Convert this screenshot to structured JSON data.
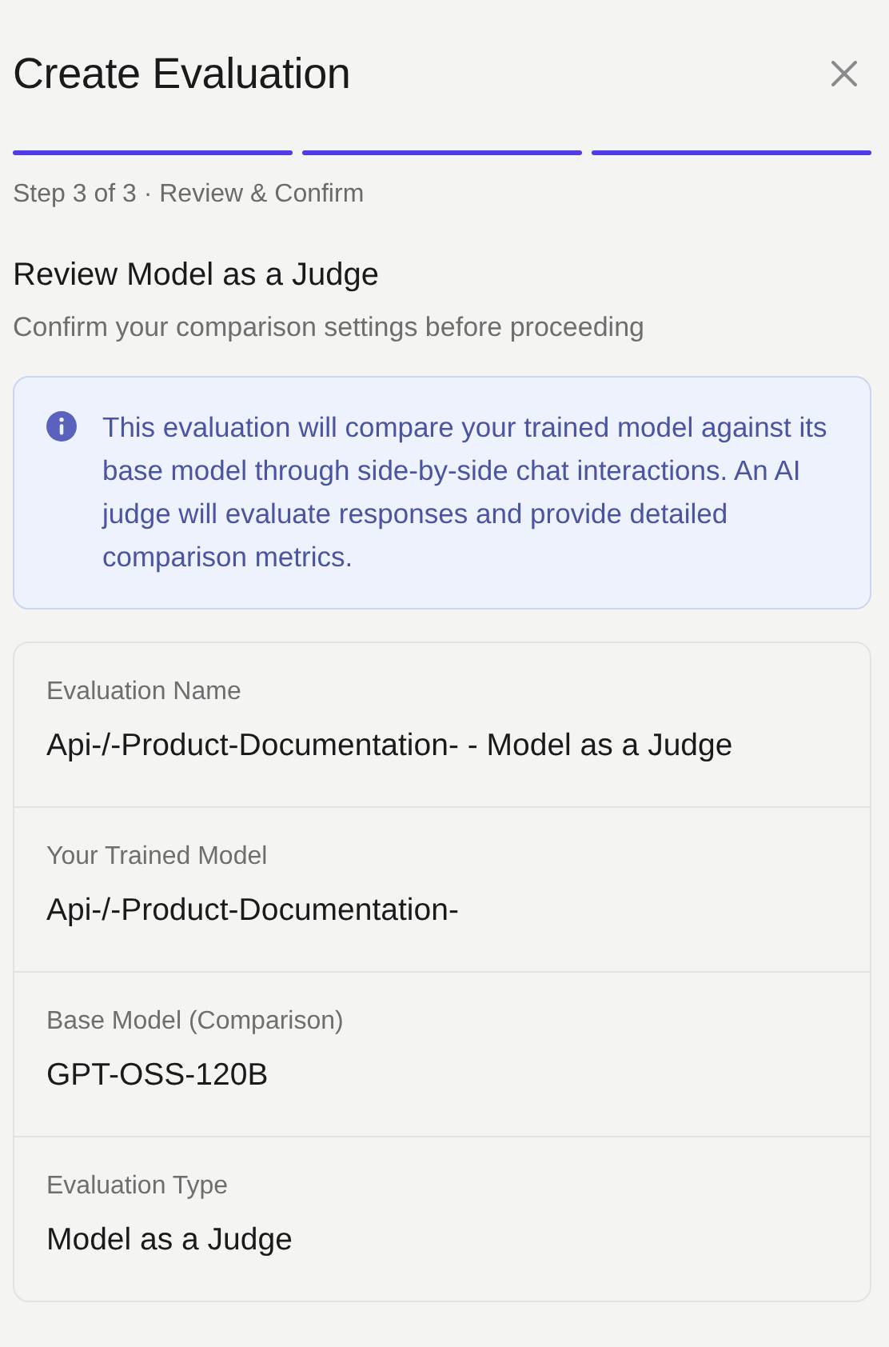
{
  "dialog": {
    "title": "Create Evaluation"
  },
  "steps": [
    {
      "completed": true
    },
    {
      "completed": true
    },
    {
      "completed": true
    }
  ],
  "step_caption": "Step 3 of 3 · Review & Confirm",
  "section": {
    "heading": "Review Model as a Judge",
    "subheading": "Confirm your comparison settings before proceeding"
  },
  "info": {
    "text": "This evaluation will compare your trained model against its base model through side-by-side chat interactions. An AI judge will evaluate responses and provide detailed comparison metrics."
  },
  "summary": [
    {
      "label": "Evaluation Name",
      "value": "Api-/-Product-Documentation- - Model as a Judge"
    },
    {
      "label": "Your Trained Model",
      "value": "Api-/-Product-Documentation-"
    },
    {
      "label": "Base Model (Comparison)",
      "value": "GPT-OSS-120B"
    },
    {
      "label": "Evaluation Type",
      "value": "Model as a Judge"
    }
  ]
}
